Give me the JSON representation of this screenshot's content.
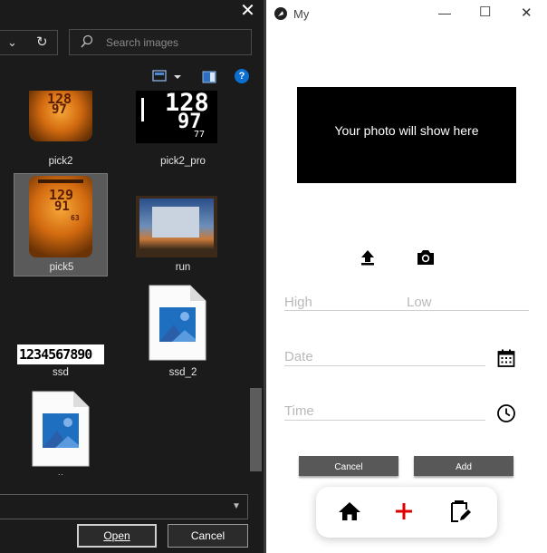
{
  "file_dialog": {
    "search_placeholder": "Search images",
    "files": [
      {
        "name": "pick2"
      },
      {
        "name": "pick2_pro"
      },
      {
        "name": "pick5",
        "selected": true
      },
      {
        "name": "run"
      },
      {
        "name": "ssd"
      },
      {
        "name": "ssd_2"
      },
      {
        "name": "tt"
      }
    ],
    "thumb_text": {
      "pick2_top": "128",
      "pick2_bottom": "97",
      "pro_top": "128",
      "pro_mid": "97",
      "pro_bottom": "77",
      "pick5_top": "129",
      "pick5_bottom": "91",
      "pick5_small": "63",
      "ssd_digits": "1234567890"
    },
    "open_label": "Open",
    "cancel_label": "Cancel",
    "colors": {
      "background": "#1b1b1b",
      "selected": "#5a5a5a",
      "help": "#0a6fd1"
    }
  },
  "app": {
    "title": "My",
    "photo_placeholder": "Your photo will show here",
    "fields": {
      "high": "High",
      "low": "Low",
      "date": "Date",
      "time": "Time"
    },
    "buttons": {
      "cancel": "Cancel",
      "add": "Add"
    },
    "nav": [
      "home-icon",
      "add-icon",
      "clipboard-edit-icon"
    ],
    "colors": {
      "accent_add": "#e00000",
      "button_bg": "#585858"
    }
  }
}
